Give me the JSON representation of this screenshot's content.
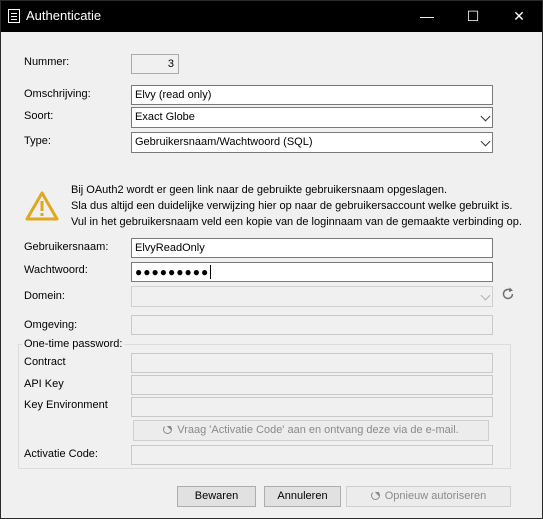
{
  "window": {
    "title": "Authenticatie",
    "minimize": "—",
    "maximize": "☐",
    "close": "✕"
  },
  "form": {
    "nummer": {
      "label": "Nummer:",
      "value": "3"
    },
    "omschrijving": {
      "label": "Omschrijving:",
      "value": "Elvy (read only)"
    },
    "soort": {
      "label": "Soort:",
      "value": "Exact Globe"
    },
    "type": {
      "label": "Type:",
      "value": "Gebruikersnaam/Wachtwoord (SQL)"
    },
    "warning": {
      "line1": "Bij OAuth2 wordt er geen link naar de gebruikte gebruikersnaam opgeslagen.",
      "line2": "Sla dus altijd een duidelijke verwijzing hier op naar de gebruikersaccount welke gebruikt is.",
      "line3": "Vul in het gebruikersnaam veld een kopie van de loginnaam van de gemaakte verbinding op."
    },
    "gebruikersnaam": {
      "label": "Gebruikersnaam:",
      "value": "ElvyReadOnly"
    },
    "wachtwoord": {
      "label": "Wachtwoord:",
      "value": "●●●●●●●●●"
    },
    "domein": {
      "label": "Domein:",
      "value": ""
    },
    "omgeving": {
      "label": "Omgeving:",
      "value": ""
    }
  },
  "otp": {
    "title": "One-time password:",
    "contract_label": "Contract",
    "apikey_label": "API Key",
    "keyenv_label": "Key Environment",
    "request_button": "Vraag 'Activatie Code' aan en ontvang deze via de e-mail.",
    "activatie_label": "Activatie Code:"
  },
  "buttons": {
    "save": "Bewaren",
    "cancel": "Annuleren",
    "reauth": "Opnieuw autoriseren"
  },
  "colors": {
    "titlebar": "#000000",
    "window_bg": "#f0f0f0",
    "warning": "#f0c030"
  }
}
